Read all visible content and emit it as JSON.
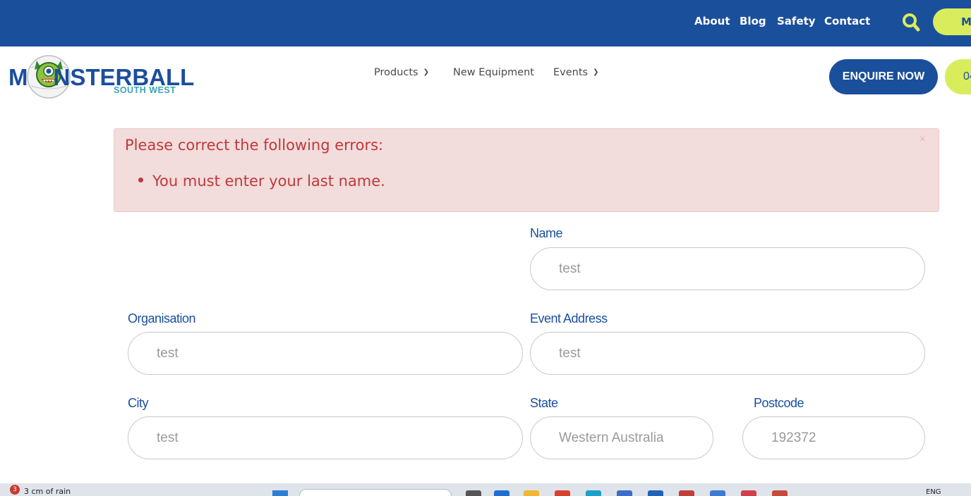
{
  "topbar": {
    "links": [
      "About",
      "Blog",
      "Safety",
      "Contact"
    ],
    "cta_label": "M"
  },
  "logo": {
    "wordmark_left": "M",
    "wordmark_right": "NSTERBALL",
    "subtitle": "SOUTH WEST"
  },
  "nav": {
    "items": [
      {
        "label": "Products",
        "has_dropdown": true
      },
      {
        "label": "New Equipment",
        "has_dropdown": false
      },
      {
        "label": "Events",
        "has_dropdown": true
      }
    ],
    "enquire_label": "ENQUIRE NOW",
    "phone_label": "04"
  },
  "alert": {
    "title": "Please correct the following errors:",
    "errors": [
      "You must enter your last name."
    ],
    "close": "×"
  },
  "form": {
    "name": {
      "label": "Name",
      "value": "test"
    },
    "organisation": {
      "label": "Organisation",
      "value": "test"
    },
    "event_address": {
      "label": "Event Address",
      "value": "test"
    },
    "city": {
      "label": "City",
      "value": "test"
    },
    "state": {
      "label": "State",
      "value": "Western Australia"
    },
    "postcode": {
      "label": "Postcode",
      "value": "192372"
    }
  },
  "taskbar": {
    "weather_badge": "3",
    "weather_text": "3 cm of rain",
    "language": "ENG"
  },
  "colors": {
    "brand_blue": "#1a4f9c",
    "accent_lime": "#d9ec5c",
    "error_red": "#c0393a",
    "error_bg": "#f2dcdc"
  }
}
